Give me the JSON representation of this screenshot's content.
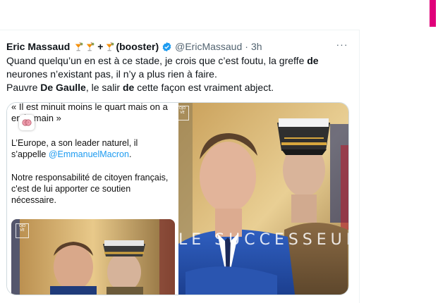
{
  "tweet": {
    "author_name": "Eric Massaud",
    "author_suffix": "(booster)",
    "plus": "+",
    "handle": "@EricMassaud",
    "separator": "·",
    "time": "3h",
    "more_label": "···",
    "text_line1": "Quand quelqu’un en est à ce stade, je crois que c’est foutu, la greffe ",
    "text_line1_bold": "de",
    "text_line2": "neurones n’existant pas, il n’y a plus rien à faire.",
    "text_line3_a": "Pauvre ",
    "text_line3_bold1": "De Gaulle",
    "text_line3_b": ", le salir ",
    "text_line3_bold2": "de",
    "text_line3_c": " cette façon est vraiment abject."
  },
  "media": {
    "quote_line1": "« Il est minuit moins le quart mais on a",
    "quote_line2": "en       la main »",
    "para1_a": "L’Europe, a son leader naturel, il s’appelle ",
    "para1_mention": "@EmmanuelMacron",
    "para1_b": ".",
    "para2": "Notre responsabilité de citoyen français, c'est de lui apporter ce soutien nécessaire.",
    "logo_text": "OJO VE",
    "overlay_text": "LE SUCCESSEUR"
  },
  "icons": {
    "emoji": "tropical-drink-icon",
    "verified": "verified-badge-icon",
    "brain": "brain-icon"
  },
  "colors": {
    "accent": "#e0007a",
    "link": "#1d9bf0",
    "verified": "#1d9bf0",
    "muted": "#536471"
  }
}
